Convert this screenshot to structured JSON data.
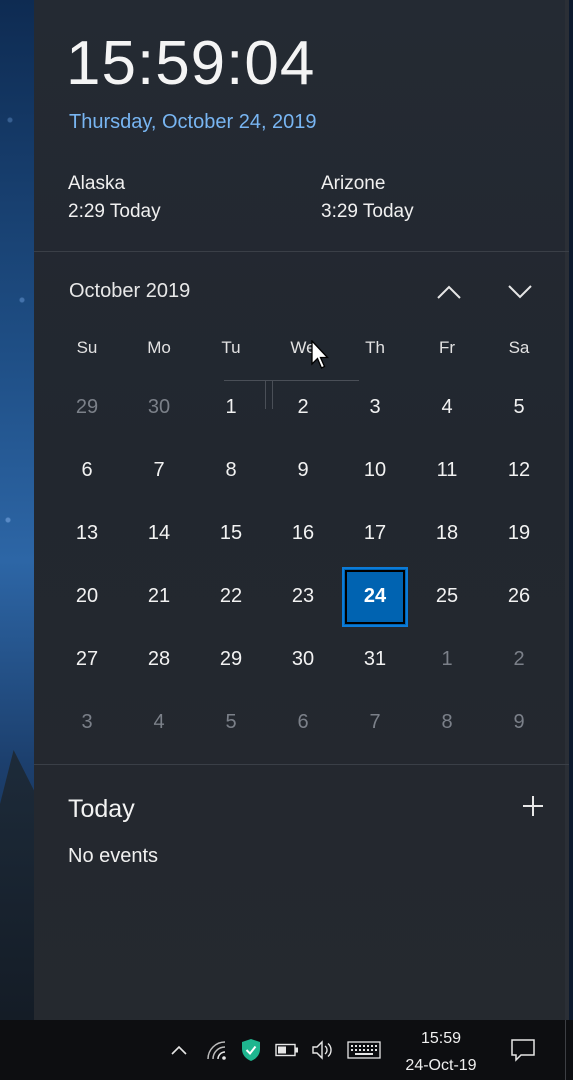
{
  "clock": {
    "time": "15:59:04",
    "date_link": "Thursday, October 24, 2019"
  },
  "timezones": [
    {
      "name": "Alaska",
      "time": "2:29 Today"
    },
    {
      "name": "Arizone",
      "time": "3:29 Today"
    }
  ],
  "calendar": {
    "month_label": "October 2019",
    "weekdays": [
      "Su",
      "Mo",
      "Tu",
      "We",
      "Th",
      "Fr",
      "Sa"
    ],
    "weeks": [
      [
        "29",
        "30",
        "1",
        "2",
        "3",
        "4",
        "5"
      ],
      [
        "6",
        "7",
        "8",
        "9",
        "10",
        "11",
        "12"
      ],
      [
        "13",
        "14",
        "15",
        "16",
        "17",
        "18",
        "19"
      ],
      [
        "20",
        "21",
        "22",
        "23",
        "24",
        "25",
        "26"
      ],
      [
        "27",
        "28",
        "29",
        "30",
        "31",
        "1",
        "2"
      ],
      [
        "3",
        "4",
        "5",
        "6",
        "7",
        "8",
        "9"
      ]
    ],
    "selected": "24",
    "icons": {
      "previous": "chevron-up-icon",
      "next": "chevron-down-icon"
    }
  },
  "agenda": {
    "title": "Today",
    "empty_text": "No events",
    "add_icon": "plus-icon"
  },
  "taskbar": {
    "time": "15:59",
    "date": "24-Oct-19",
    "icons": [
      "chevron-up-icon",
      "wifi-icon",
      "shield-icon",
      "battery-icon",
      "volume-icon",
      "keyboard-icon",
      "notification-icon"
    ],
    "colors": {
      "shield": "#1fb58f",
      "background": "#0d0e11"
    }
  },
  "colors": {
    "accent": "#0063b1",
    "link": "#78b5f2",
    "panel": "#23282f",
    "dim_text": "#7b8089"
  }
}
